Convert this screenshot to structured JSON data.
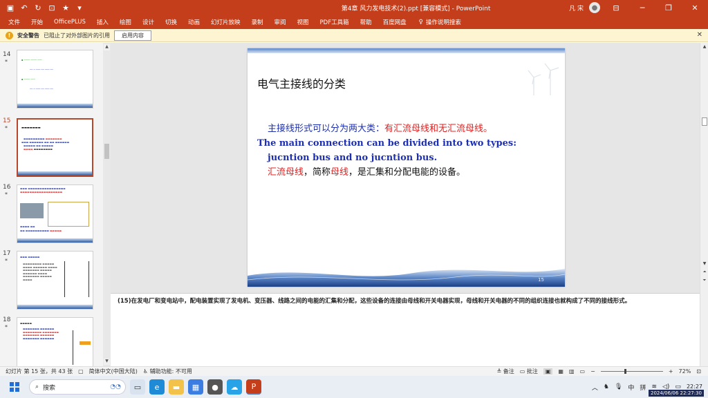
{
  "window": {
    "title": "第4章 风力发电技术(2).ppt [兼容模式] - PowerPoint",
    "user": "凡 宋"
  },
  "ribbon": {
    "tabs": [
      "文件",
      "开始",
      "OfficePLUS",
      "插入",
      "绘图",
      "设计",
      "切换",
      "动画",
      "幻灯片放映",
      "录制",
      "审阅",
      "视图",
      "PDF工具箱",
      "帮助",
      "百度网盘"
    ],
    "tell_me": "操作说明搜索"
  },
  "security_bar": {
    "label": "安全警告",
    "message": "已阻止了对外部图片的引用",
    "button": "启用内容"
  },
  "thumbnails": [
    {
      "number": "14",
      "star": "*"
    },
    {
      "number": "15",
      "star": "*"
    },
    {
      "number": "16",
      "star": "*"
    },
    {
      "number": "17",
      "star": "*"
    },
    {
      "number": "18",
      "star": "*"
    }
  ],
  "slide": {
    "title": "电气主接线的分类",
    "line1_a": "主接线形式可以分为两大类：",
    "line1_b": "有汇流母线和无汇流母线。",
    "line2": "The main connection can be divided into two types:",
    "line3": "jucntion bus and no jucntion bus.",
    "line4_a": "汇流母线",
    "line4_b": "，简称",
    "line4_c": "母线",
    "line4_d": "，是汇集和分配电能的设备。",
    "number": "15"
  },
  "notes": "(15)在发电厂和变电站中，配电装置实现了发电机、变压器、线路之间的电能的汇集和分配，这些设备的连接由母线和开关电器实现，母线和开关电器的不同的组织连接也就构成了不同的接线形式。",
  "status": {
    "slide_info": "幻灯片 第 15 张，共 43 张",
    "language": "简体中文(中国大陆)",
    "accessibility": "辅助功能: 不可用",
    "notes_btn": "备注",
    "comments_btn": "批注",
    "zoom": "72%"
  },
  "taskbar": {
    "search": "搜索",
    "ime": "中",
    "ime2": "拼",
    "time": "22:27",
    "date": "2024/06/06 22:27:30"
  },
  "colors": {
    "accent": "#c43e1c",
    "slide_blue": "#1c2fb0",
    "slide_red": "#e02020"
  }
}
